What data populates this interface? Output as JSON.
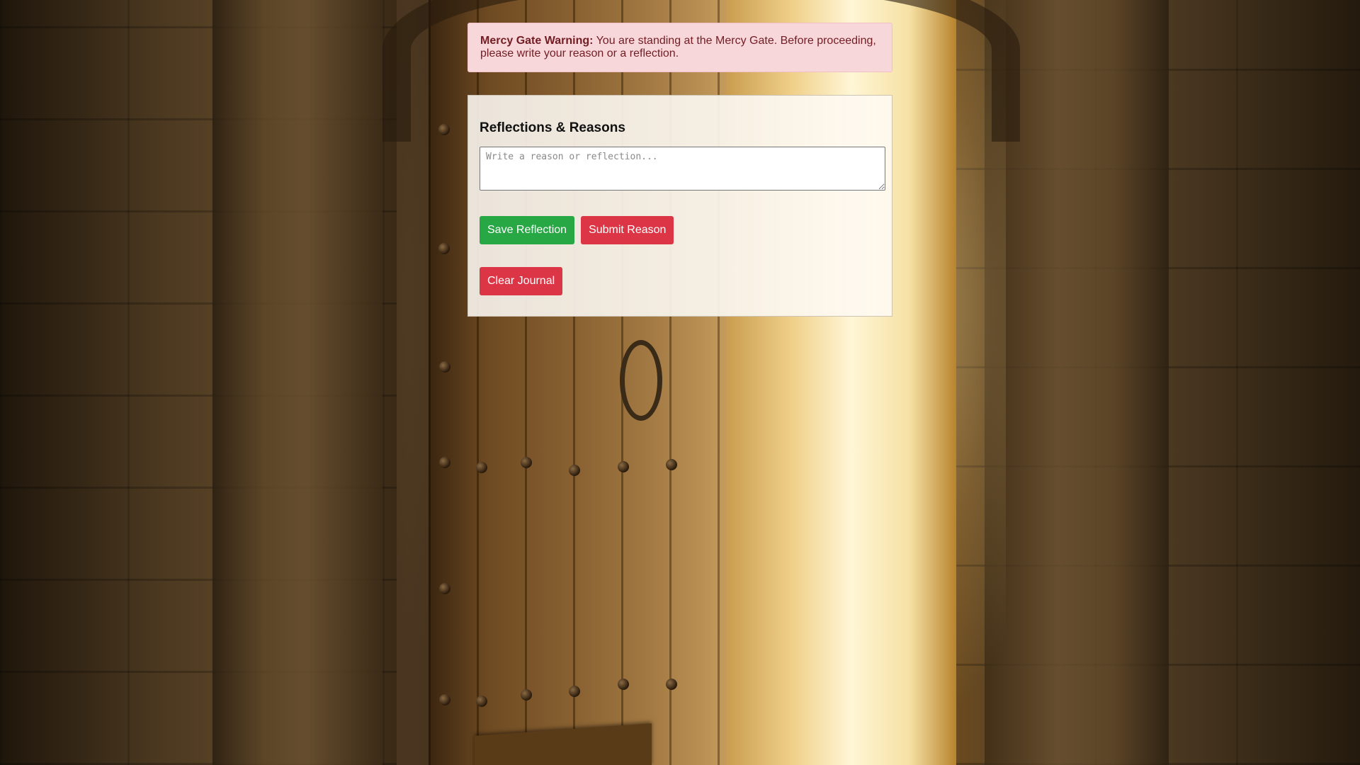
{
  "warning": {
    "title": "Mercy Gate Warning:",
    "message": " You are standing at the Mercy Gate. Before proceeding, please write your reason or a reflection."
  },
  "journal": {
    "heading": "Reflections & Reasons",
    "textarea_placeholder": "Write a reason or reflection...",
    "textarea_value": "",
    "save_label": "Save Reflection",
    "submit_label": "Submit Reason",
    "clear_label": "Clear Journal"
  },
  "colors": {
    "warning_bg": "#f8d7da",
    "warning_text": "#721c24",
    "save_button": "#28a745",
    "danger_button": "#dc3545"
  },
  "background": {
    "icon": "open-wooden-door-scene"
  }
}
